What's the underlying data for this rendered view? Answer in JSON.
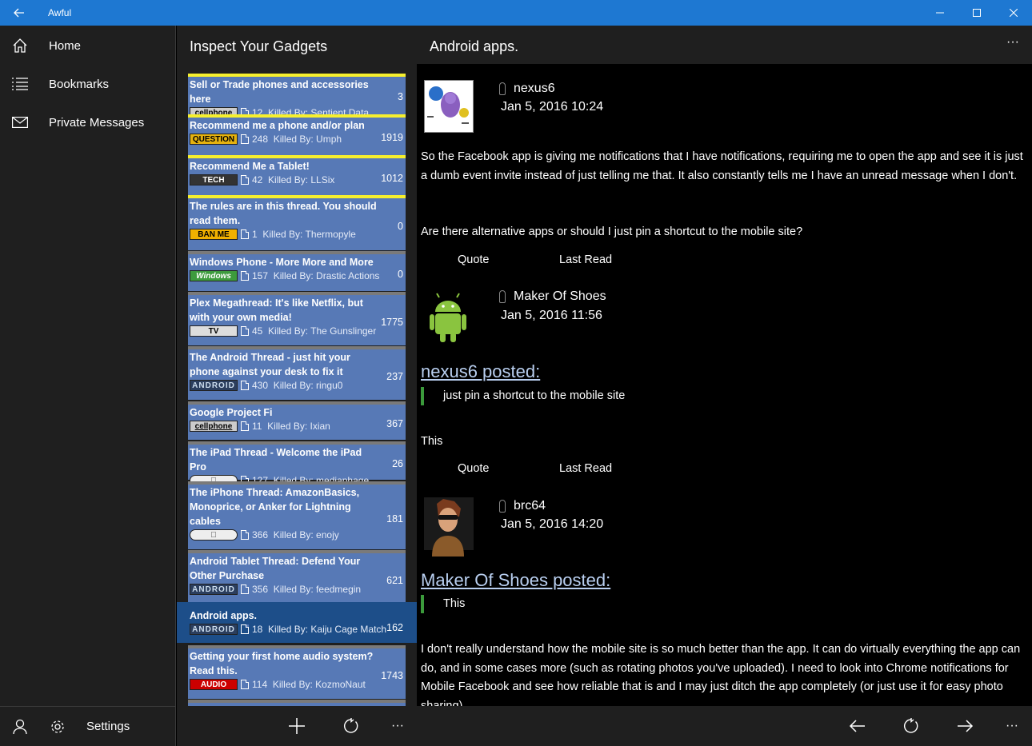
{
  "app": {
    "title": "Awful"
  },
  "nav": {
    "items": [
      {
        "label": "Home",
        "icon": "home-icon"
      },
      {
        "label": "Bookmarks",
        "icon": "list-icon"
      },
      {
        "label": "Private Messages",
        "icon": "mail-icon"
      }
    ],
    "settings_label": "Settings"
  },
  "forum": {
    "title": "Inspect Your Gadgets",
    "threads": [
      {
        "title": "Sell or Trade phones and accessories here",
        "tag": "cellphone",
        "replies": "12",
        "killed_by": "Killed By: Sentient Data",
        "count": "3",
        "sticky": true
      },
      {
        "title": "Recommend me a phone and/or plan",
        "tag": "QUESTION",
        "replies": "248",
        "killed_by": "Killed By: Umph",
        "count": "1919",
        "sticky": true
      },
      {
        "title": "Recommend Me a Tablet!",
        "tag": "TECH",
        "replies": "42",
        "killed_by": "Killed By: LLSix",
        "count": "1012",
        "sticky": true
      },
      {
        "title": "The rules are in this thread.  You should read them.",
        "tag": "BAN ME",
        "replies": "1",
        "killed_by": "Killed By: Thermopyle",
        "count": "0",
        "sticky": true
      },
      {
        "title": "Windows Phone - More More and More",
        "tag": "Windows",
        "replies": "157",
        "killed_by": "Killed By: Drastic Actions",
        "count": "0",
        "sticky": false
      },
      {
        "title": "Plex Megathread: It's like Netflix, but with your own media!",
        "tag": "TV",
        "replies": "45",
        "killed_by": "Killed By: The Gunslinger",
        "count": "1775",
        "sticky": false
      },
      {
        "title": "The Android Thread - just hit your phone against your desk to fix it",
        "tag": "ANDROID",
        "replies": "430",
        "killed_by": "Killed By: ringu0",
        "count": "237",
        "sticky": false
      },
      {
        "title": "Google Project Fi",
        "tag": "cellphone",
        "replies": "11",
        "killed_by": "Killed By: Ixian",
        "count": "367",
        "sticky": false
      },
      {
        "title": "The iPad Thread - Welcome the iPad Pro",
        "tag": "",
        "replies": "127",
        "killed_by": "Killed By: mediaphage",
        "count": "26",
        "sticky": false
      },
      {
        "title": "The iPhone Thread: AmazonBasics, Monoprice, or Anker for Lightning cables",
        "tag": "",
        "replies": "366",
        "killed_by": "Killed By: enojy",
        "count": "181",
        "sticky": false
      },
      {
        "title": "Android Tablet Thread: Defend Your Other Purchase",
        "tag": "ANDROID",
        "replies": "356",
        "killed_by": "Killed By: feedmegin",
        "count": "621",
        "sticky": false
      },
      {
        "title": "Android apps.",
        "tag": "ANDROID",
        "replies": "18",
        "killed_by": "Killed By: Kaiju Cage Match",
        "count": "162",
        "sticky": false
      },
      {
        "title": "Getting your first home audio system? Read this.",
        "tag": "AUDIO",
        "replies": "114",
        "killed_by": "Killed By: KozmoNaut",
        "count": "1743",
        "sticky": false
      }
    ]
  },
  "thread": {
    "title": "Android apps.",
    "more_label": "···",
    "posts": [
      {
        "author": "nexus6",
        "date": "Jan 5, 2016 10:24",
        "text1": "So the Facebook app is giving me notifications that I have notifications, requiring me to open the app and see it is just a dumb event invite instead of just telling me that. It also constantly tells me I have an unread message when I don't.",
        "text2": "Are there alternative apps or should I just pin a shortcut to the mobile site?",
        "quote_label": "Quote",
        "last_read_label": "Last Read"
      },
      {
        "author": "Maker Of Shoes",
        "date": "Jan 5, 2016 11:56",
        "quote_head": "nexus6 posted:",
        "quote_body": "just pin a shortcut to the mobile site",
        "text1": "This",
        "quote_label": "Quote",
        "last_read_label": "Last Read"
      },
      {
        "author": "brc64",
        "date": "Jan 5, 2016 14:20",
        "quote_head": "Maker Of Shoes posted:",
        "quote_body": "This",
        "text1": "I don't really understand how the mobile site is so much better than the app. It can do virtually everything the app can do, and in some cases more (such as rotating photos you've uploaded). I need to look into Chrome notifications for Mobile Facebook and see how reliable that is and I may just ditch the app completely (or just use it for easy photo sharing)."
      }
    ]
  },
  "toolbar": {
    "list_more": "···",
    "post_more": "···"
  }
}
